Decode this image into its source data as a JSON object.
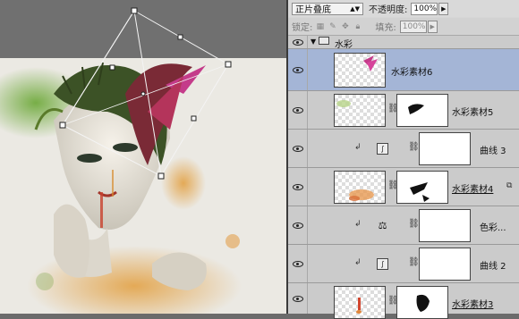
{
  "colors": {
    "panel_bg": "#d6d6d6",
    "selected_row": "#a4b5d6",
    "canvas_gray": "#707070",
    "paper": "#e9e7e1"
  },
  "blend_mode": "正片叠底",
  "opacity_label": "不透明度:",
  "opacity_value": "100%",
  "lock_label": "锁定:",
  "fill_label": "填充:",
  "fill_value": "100%",
  "group": {
    "name": "水彩",
    "icon": "folder-icon",
    "expanded": true
  },
  "layers": [
    {
      "name": "水彩素材6",
      "type": "pixel",
      "selected": true
    },
    {
      "name": "水彩素材5",
      "type": "pixel-with-mask"
    },
    {
      "name": "曲线 3",
      "type": "adjustment",
      "adj_icon": "curves-icon",
      "clipped": true
    },
    {
      "name": "水彩素材4",
      "type": "pixel-with-mask",
      "underline": true,
      "smart_icon": true
    },
    {
      "name": "色彩...",
      "type": "adjustment",
      "adj_icon": "color-balance-icon",
      "clipped": true
    },
    {
      "name": "曲线 2",
      "type": "adjustment",
      "adj_icon": "curves-icon",
      "clipped": true
    },
    {
      "name": "水彩素材3",
      "type": "pixel-with-mask",
      "underline": true
    }
  ]
}
